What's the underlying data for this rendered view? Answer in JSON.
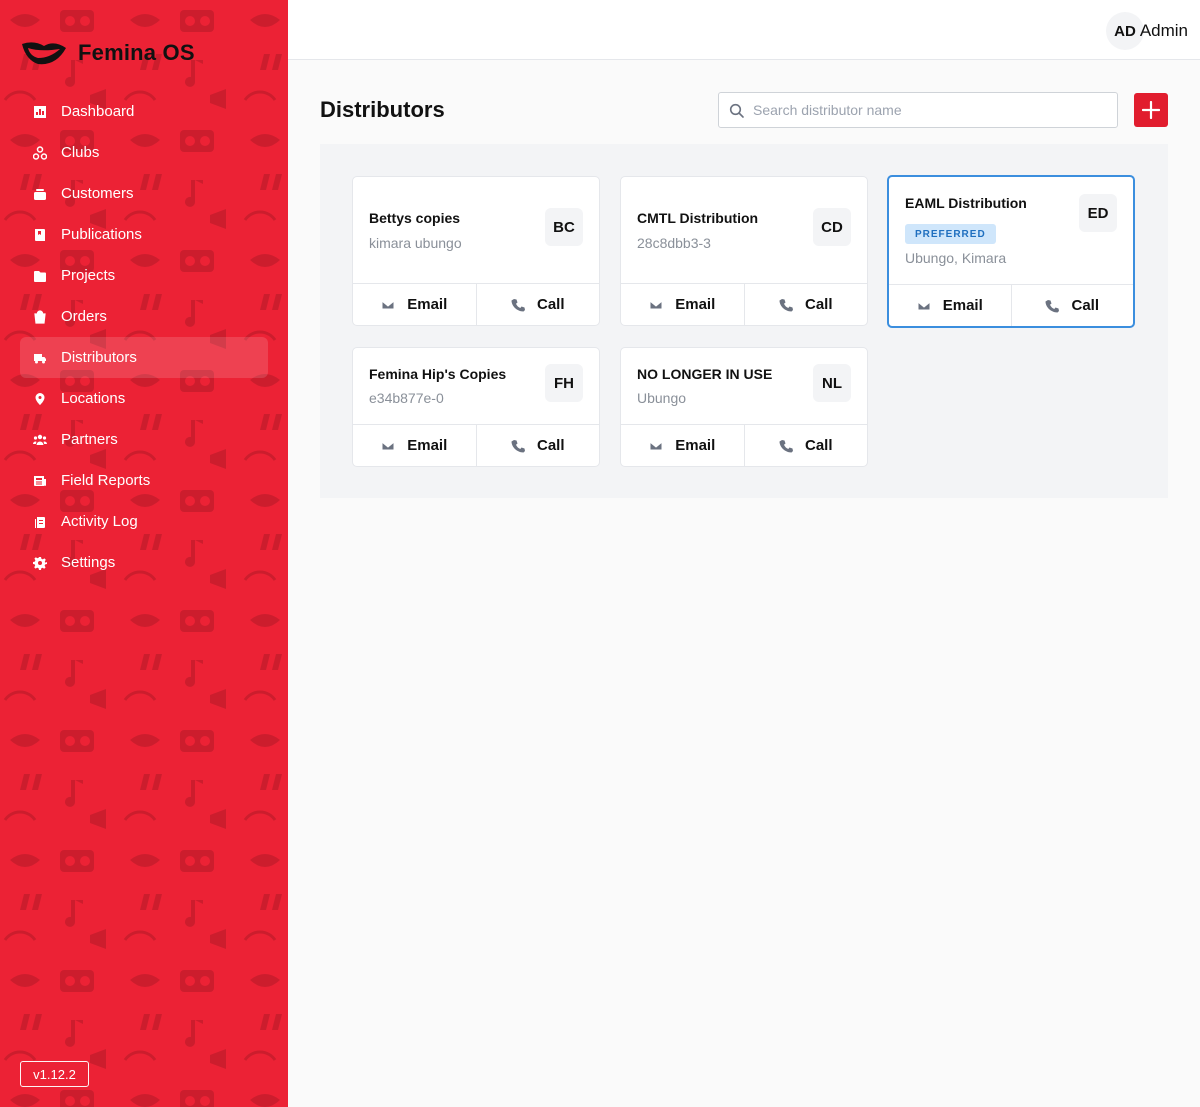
{
  "app": {
    "name": "Femina OS",
    "version": "v1.12.2"
  },
  "sidebar": {
    "items": [
      {
        "label": "Dashboard",
        "icon": "chart-icon"
      },
      {
        "label": "Clubs",
        "icon": "clubs-icon"
      },
      {
        "label": "Customers",
        "icon": "customers-icon"
      },
      {
        "label": "Publications",
        "icon": "book-icon"
      },
      {
        "label": "Projects",
        "icon": "folder-icon"
      },
      {
        "label": "Orders",
        "icon": "shopping-bag-icon"
      },
      {
        "label": "Distributors",
        "icon": "truck-icon",
        "active": true
      },
      {
        "label": "Locations",
        "icon": "map-pin-icon"
      },
      {
        "label": "Partners",
        "icon": "users-icon"
      },
      {
        "label": "Field Reports",
        "icon": "newspaper-icon"
      },
      {
        "label": "Activity Log",
        "icon": "clipboard-icon"
      },
      {
        "label": "Settings",
        "icon": "gear-icon"
      }
    ]
  },
  "header": {
    "avatar_initials": "AD",
    "user_name": "Admin"
  },
  "main": {
    "title": "Distributors",
    "search_placeholder": "Search distributor name",
    "action_email": "Email",
    "action_call": "Call",
    "distributors": [
      {
        "name": "Bettys copies",
        "sub": "kimara ubungo",
        "initials": "BC"
      },
      {
        "name": "CMTL Distribution",
        "sub": "28c8dbb3-3",
        "initials": "CD"
      },
      {
        "name": "EAML Distribution",
        "badge": "PREFERRED",
        "sub": "Ubungo, Kimara",
        "initials": "ED"
      },
      {
        "name": "Femina Hip's Copies",
        "sub": "e34b877e-0",
        "initials": "FH"
      },
      {
        "name": "NO LONGER IN USE",
        "sub": "Ubungo",
        "initials": "NL"
      }
    ]
  },
  "colors": {
    "brand_red": "#ec2235",
    "preferred_border": "#3b8ede",
    "badge_bg": "#cfe6fb",
    "badge_text": "#1f6fbf"
  }
}
